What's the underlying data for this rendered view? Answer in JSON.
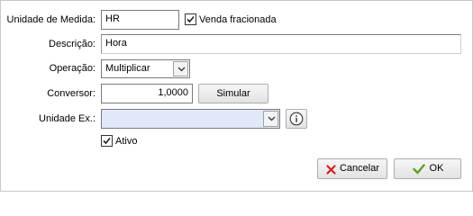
{
  "form": {
    "unidade_label": "Unidade de Medida:",
    "unidade_value": "HR",
    "venda_fracionada_label": "Venda fracionada",
    "venda_fracionada_checked": true,
    "descricao_label": "Descrição:",
    "descricao_value": "Hora",
    "operacao_label": "Operação:",
    "operacao_value": "Multiplicar",
    "conversor_label": "Conversor:",
    "conversor_value": "1,0000",
    "simular_label": "Simular",
    "unidade_ex_label": "Unidade Ex.:",
    "unidade_ex_value": "",
    "ativo_label": "Ativo",
    "ativo_checked": true
  },
  "footer": {
    "cancelar_label": "Cancelar",
    "ok_label": "OK"
  },
  "colors": {
    "cancel_icon": "#d21f1f",
    "ok_icon": "#5aa02c",
    "selection_fill": "#dfe9f9",
    "info_icon": "#333333"
  }
}
